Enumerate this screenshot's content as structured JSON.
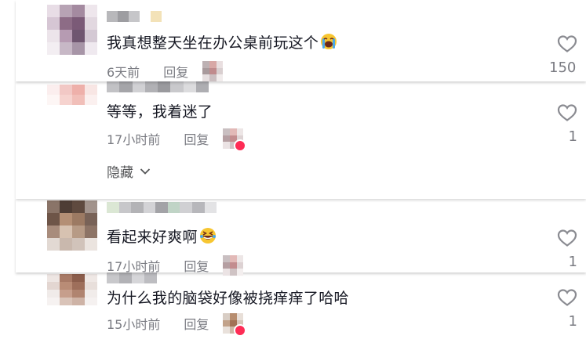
{
  "comments": [
    {
      "text": "我真想整天坐在办公桌前玩这个",
      "emoji": "loudly-crying-face",
      "time": "6天前",
      "reply": "回复",
      "likes": "150"
    },
    {
      "text": "等等，我着迷了",
      "time": "17小时前",
      "reply": "回复",
      "likes": "1",
      "hide_label": "隐藏"
    },
    {
      "text": "看起来好爽啊",
      "emoji": "grinning-squinting-face",
      "time": "17小时前",
      "reply": "回复",
      "likes": "1"
    },
    {
      "text": "为什么我的脑袋好像被挠痒痒了哈哈",
      "time": "15小时前",
      "reply": "回复",
      "likes": "1"
    }
  ],
  "colors": {
    "text": "#161823",
    "muted": "#7a7b82",
    "heart": "#8a8b91",
    "accent": "#fe2c55"
  }
}
